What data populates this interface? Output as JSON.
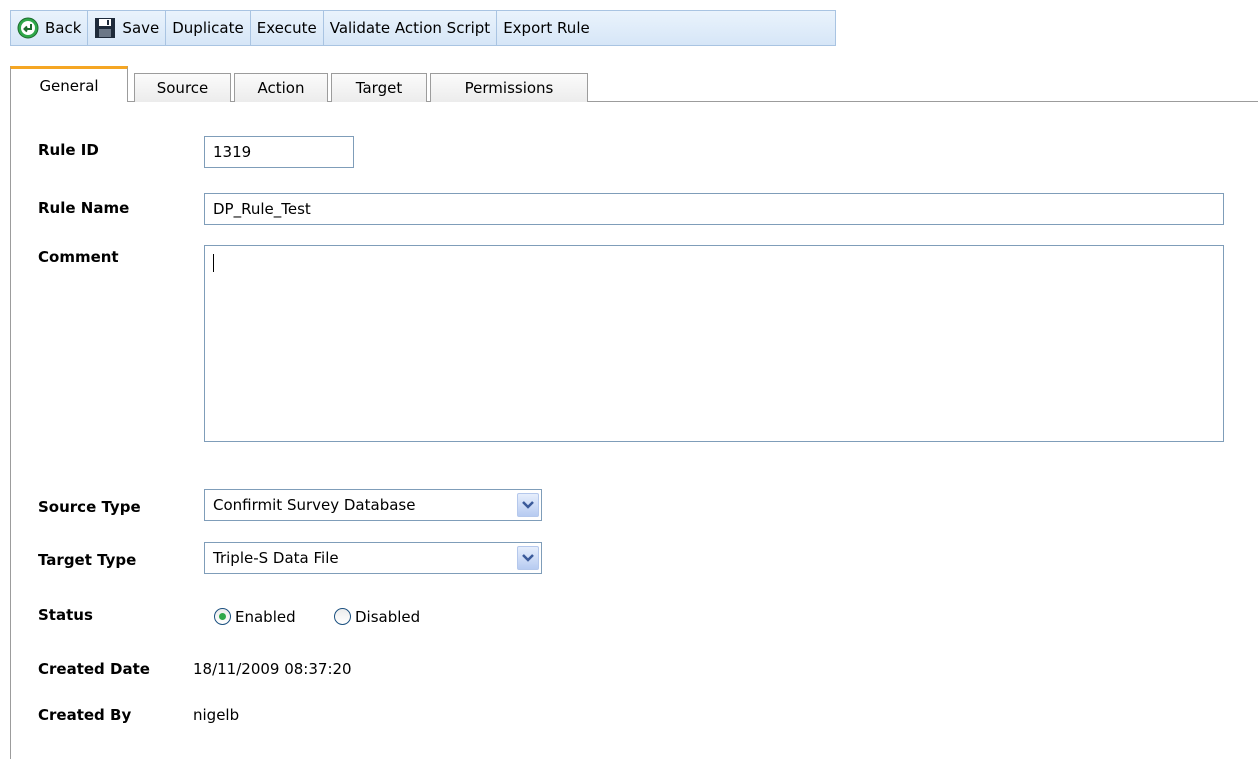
{
  "toolbar": {
    "back": "Back",
    "save": "Save",
    "duplicate": "Duplicate",
    "execute": "Execute",
    "validate": "Validate Action Script",
    "export": "Export Rule"
  },
  "tabs": [
    {
      "label": "General",
      "active": true
    },
    {
      "label": "Source",
      "active": false
    },
    {
      "label": "Action",
      "active": false
    },
    {
      "label": "Target",
      "active": false
    },
    {
      "label": "Permissions",
      "active": false
    }
  ],
  "form": {
    "rule_id_label": "Rule ID",
    "rule_id_value": "1319",
    "rule_name_label": "Rule Name",
    "rule_name_value": "DP_Rule_Test",
    "comment_label": "Comment",
    "comment_value": "",
    "source_type_label": "Source Type",
    "source_type_value": "Confirmit Survey Database",
    "target_type_label": "Target Type",
    "target_type_value": "Triple-S Data File",
    "status_label": "Status",
    "status_enabled": "Enabled",
    "status_disabled": "Disabled",
    "status_selected": "Enabled",
    "created_date_label": "Created Date",
    "created_date_value": "18/11/2009 08:37:20",
    "created_by_label": "Created By",
    "created_by_value": "nigelb"
  },
  "colors": {
    "toolbar_bg": "#d6e6f7",
    "active_tab_accent": "#f5a623",
    "back_icon": "#2fa84a"
  },
  "icons": {
    "back": "back-arrow-circle-icon",
    "save": "floppy-disk-icon",
    "dropdown": "chevron-down-icon"
  }
}
